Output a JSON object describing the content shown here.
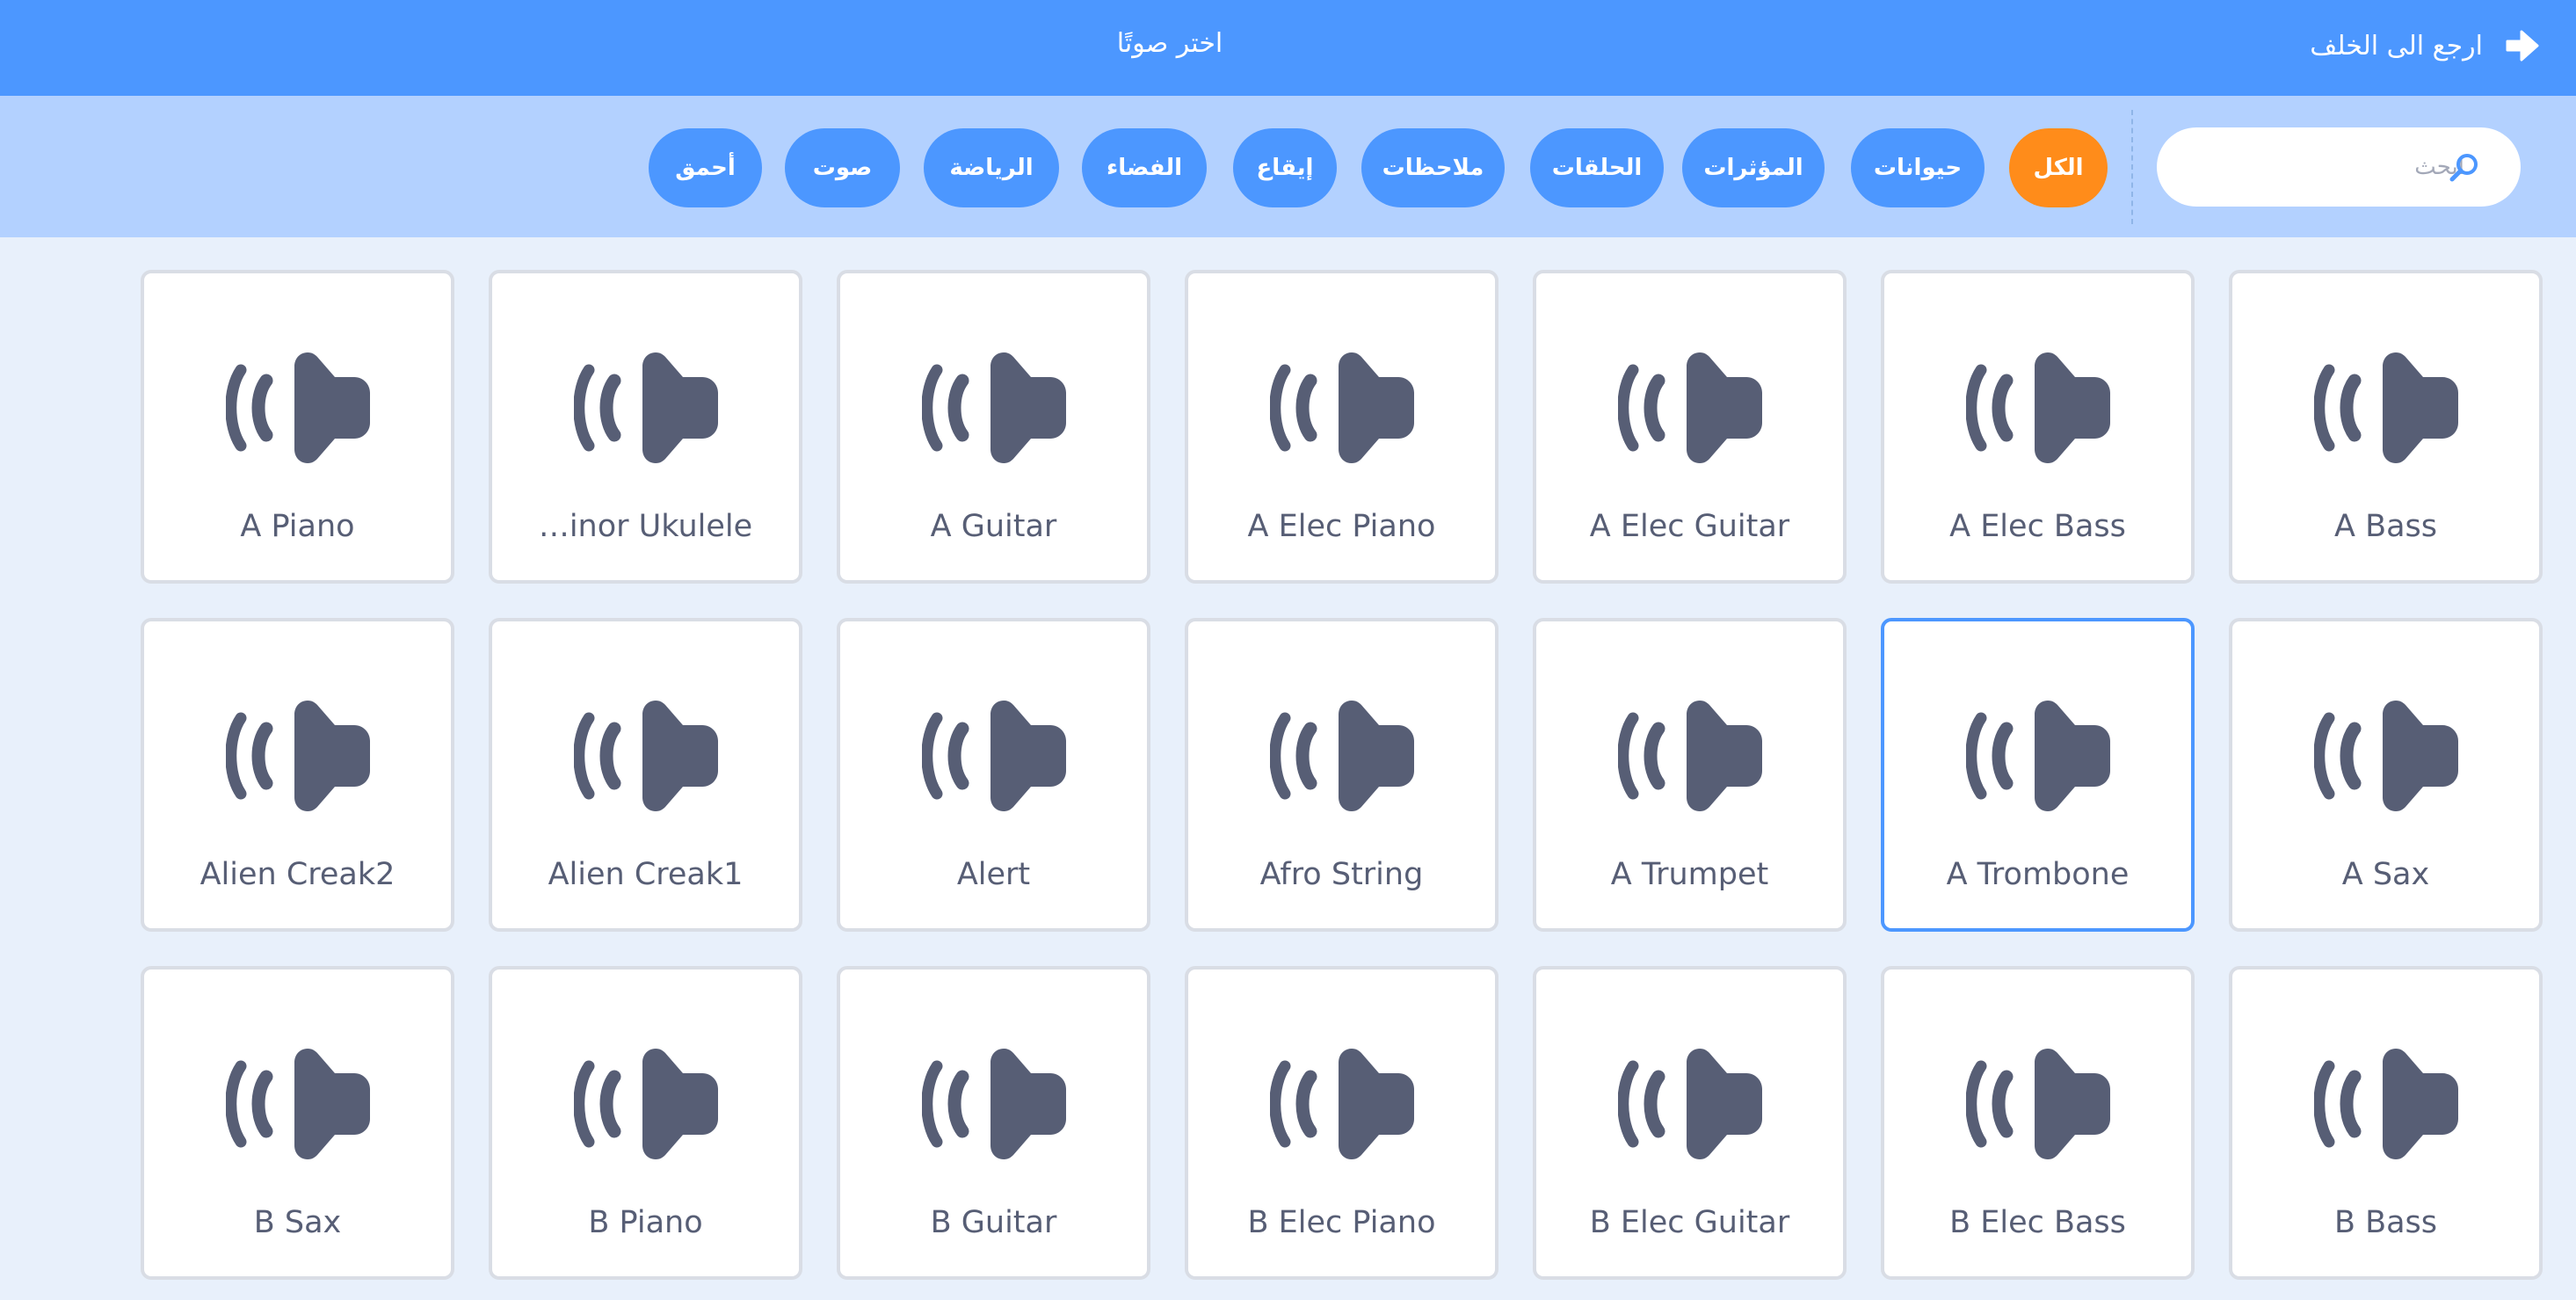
{
  "header": {
    "title": "اختر صوتًا",
    "back_label": "ارجع الى الخلف",
    "back_icon": "arrow-right-icon",
    "background": "#4c97ff"
  },
  "filter_bar": {
    "search_placeholder": "ابحث",
    "search_icon": "search-icon",
    "tags": [
      {
        "key": "all",
        "label": "الكل",
        "active": true
      },
      {
        "key": "animals",
        "label": "حيوانات"
      },
      {
        "key": "effects",
        "label": "المؤثرات"
      },
      {
        "key": "loops",
        "label": "الحلقات"
      },
      {
        "key": "notes",
        "label": "ملاحظات"
      },
      {
        "key": "percussion",
        "label": "إيقاع"
      },
      {
        "key": "space",
        "label": "الفضاء"
      },
      {
        "key": "sports",
        "label": "الرياضة"
      },
      {
        "key": "voice",
        "label": "صوت"
      },
      {
        "key": "wacky",
        "label": "أحمق"
      }
    ],
    "active_color": "#ff8c1a",
    "tag_color": "#4c97ff"
  },
  "sounds": {
    "icon": "speaker-icon",
    "selected_index": 12,
    "rows": [
      [
        "A Piano",
        "…inor Ukulele",
        "A Guitar",
        "A Elec Piano",
        "A Elec Guitar",
        "A Elec Bass",
        "A Bass"
      ],
      [
        "Alien Creak2",
        "Alien Creak1",
        "Alert",
        "Afro String",
        "A Trumpet",
        "A Trombone",
        "A Sax"
      ],
      [
        "B Sax",
        "B Piano",
        "B Guitar",
        "B Elec Piano",
        "B Elec Guitar",
        "B Elec Bass",
        "B Bass"
      ]
    ]
  }
}
